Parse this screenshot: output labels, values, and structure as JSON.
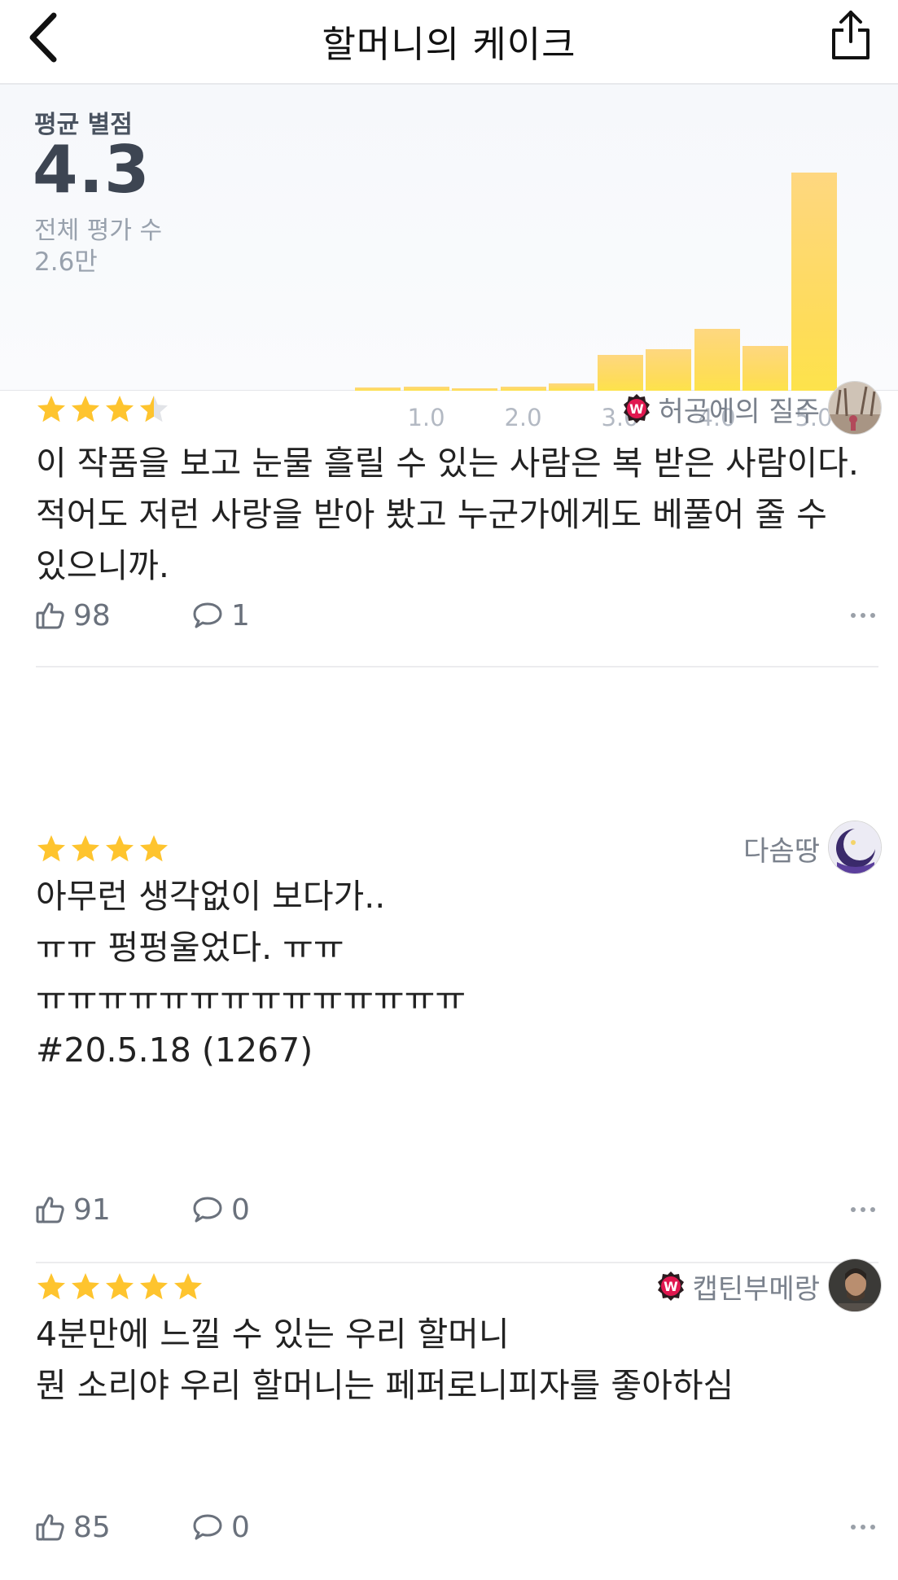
{
  "header": {
    "title": "할머니의 케이크",
    "back_icon": "chevron-left-icon",
    "share_icon": "share-icon"
  },
  "summary": {
    "avg_label": "평균 별점",
    "avg_value": "4.3",
    "count_label": "전체 평가 수",
    "count_value": "2.6만"
  },
  "chart_data": {
    "type": "bar",
    "categories": [
      "0.5",
      "1.0",
      "1.5",
      "2.0",
      "2.5",
      "3.0",
      "3.5",
      "4.0",
      "4.5",
      "5.0"
    ],
    "values": [
      1.5,
      2.0,
      0.8,
      2.0,
      3.5,
      16.5,
      19.0,
      28.5,
      20.5,
      100
    ],
    "tick_labels": [
      "1.0",
      "2.0",
      "3.0",
      "4.0",
      "5.0"
    ],
    "ylim": [
      0,
      100
    ],
    "grid": false,
    "colors": {
      "bar_top": "#fed780",
      "bar_bottom": "#fde34b"
    }
  },
  "reviews": [
    {
      "rating": 3.5,
      "user": "허공에의 질주",
      "badge": "w-badge-icon",
      "avatar": "avatar-photo",
      "text": "이 작품을 보고 눈물 흘릴 수 있는 사람은 복 받은 사람이다.\n적어도 저런 사랑을 받아 봤고 누군가에게도 베풀어 줄 수\n있으니까.",
      "likes": "98",
      "comments": "1"
    },
    {
      "rating": 4,
      "user": "다솜땅",
      "badge": "",
      "avatar": "avatar-moon",
      "text": "아무런 생각없이 보다가..\nㅠㅠ 펑펑울었다. ㅠㅠ\nㅠㅠㅠㅠㅠㅠㅠㅠㅠㅠㅠㅠㅠㅠ\n#20.5.18 (1267)",
      "likes": "91",
      "comments": "0"
    },
    {
      "rating": 5,
      "user": "캡틴부메랑",
      "badge": "w-badge-icon",
      "avatar": "avatar-portrait",
      "text": "4분만에 느낄 수 있는 우리 할머니\n뭔 소리야 우리 할머니는 페퍼로니피자를 좋아하심",
      "likes": "85",
      "comments": "0"
    }
  ],
  "colors": {
    "star": "#fec42e",
    "star_empty": "#e2e4e8",
    "badge": "#e0174f"
  }
}
